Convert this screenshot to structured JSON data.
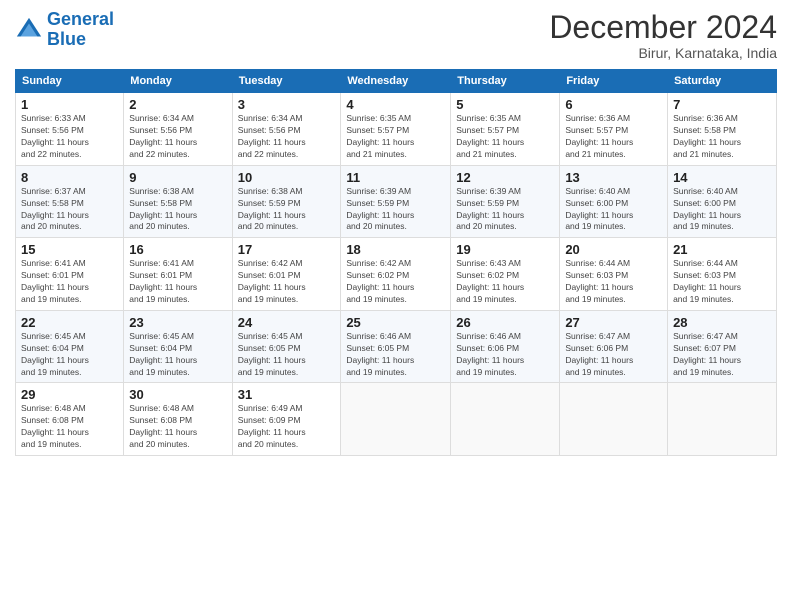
{
  "logo": {
    "line1": "General",
    "line2": "Blue"
  },
  "title": "December 2024",
  "subtitle": "Birur, Karnataka, India",
  "days_header": [
    "Sunday",
    "Monday",
    "Tuesday",
    "Wednesday",
    "Thursday",
    "Friday",
    "Saturday"
  ],
  "weeks": [
    [
      {
        "day": "1",
        "info": "Sunrise: 6:33 AM\nSunset: 5:56 PM\nDaylight: 11 hours\nand 22 minutes."
      },
      {
        "day": "2",
        "info": "Sunrise: 6:34 AM\nSunset: 5:56 PM\nDaylight: 11 hours\nand 22 minutes."
      },
      {
        "day": "3",
        "info": "Sunrise: 6:34 AM\nSunset: 5:56 PM\nDaylight: 11 hours\nand 22 minutes."
      },
      {
        "day": "4",
        "info": "Sunrise: 6:35 AM\nSunset: 5:57 PM\nDaylight: 11 hours\nand 21 minutes."
      },
      {
        "day": "5",
        "info": "Sunrise: 6:35 AM\nSunset: 5:57 PM\nDaylight: 11 hours\nand 21 minutes."
      },
      {
        "day": "6",
        "info": "Sunrise: 6:36 AM\nSunset: 5:57 PM\nDaylight: 11 hours\nand 21 minutes."
      },
      {
        "day": "7",
        "info": "Sunrise: 6:36 AM\nSunset: 5:58 PM\nDaylight: 11 hours\nand 21 minutes."
      }
    ],
    [
      {
        "day": "8",
        "info": "Sunrise: 6:37 AM\nSunset: 5:58 PM\nDaylight: 11 hours\nand 20 minutes."
      },
      {
        "day": "9",
        "info": "Sunrise: 6:38 AM\nSunset: 5:58 PM\nDaylight: 11 hours\nand 20 minutes."
      },
      {
        "day": "10",
        "info": "Sunrise: 6:38 AM\nSunset: 5:59 PM\nDaylight: 11 hours\nand 20 minutes."
      },
      {
        "day": "11",
        "info": "Sunrise: 6:39 AM\nSunset: 5:59 PM\nDaylight: 11 hours\nand 20 minutes."
      },
      {
        "day": "12",
        "info": "Sunrise: 6:39 AM\nSunset: 5:59 PM\nDaylight: 11 hours\nand 20 minutes."
      },
      {
        "day": "13",
        "info": "Sunrise: 6:40 AM\nSunset: 6:00 PM\nDaylight: 11 hours\nand 19 minutes."
      },
      {
        "day": "14",
        "info": "Sunrise: 6:40 AM\nSunset: 6:00 PM\nDaylight: 11 hours\nand 19 minutes."
      }
    ],
    [
      {
        "day": "15",
        "info": "Sunrise: 6:41 AM\nSunset: 6:01 PM\nDaylight: 11 hours\nand 19 minutes."
      },
      {
        "day": "16",
        "info": "Sunrise: 6:41 AM\nSunset: 6:01 PM\nDaylight: 11 hours\nand 19 minutes."
      },
      {
        "day": "17",
        "info": "Sunrise: 6:42 AM\nSunset: 6:01 PM\nDaylight: 11 hours\nand 19 minutes."
      },
      {
        "day": "18",
        "info": "Sunrise: 6:42 AM\nSunset: 6:02 PM\nDaylight: 11 hours\nand 19 minutes."
      },
      {
        "day": "19",
        "info": "Sunrise: 6:43 AM\nSunset: 6:02 PM\nDaylight: 11 hours\nand 19 minutes."
      },
      {
        "day": "20",
        "info": "Sunrise: 6:44 AM\nSunset: 6:03 PM\nDaylight: 11 hours\nand 19 minutes."
      },
      {
        "day": "21",
        "info": "Sunrise: 6:44 AM\nSunset: 6:03 PM\nDaylight: 11 hours\nand 19 minutes."
      }
    ],
    [
      {
        "day": "22",
        "info": "Sunrise: 6:45 AM\nSunset: 6:04 PM\nDaylight: 11 hours\nand 19 minutes."
      },
      {
        "day": "23",
        "info": "Sunrise: 6:45 AM\nSunset: 6:04 PM\nDaylight: 11 hours\nand 19 minutes."
      },
      {
        "day": "24",
        "info": "Sunrise: 6:45 AM\nSunset: 6:05 PM\nDaylight: 11 hours\nand 19 minutes."
      },
      {
        "day": "25",
        "info": "Sunrise: 6:46 AM\nSunset: 6:05 PM\nDaylight: 11 hours\nand 19 minutes."
      },
      {
        "day": "26",
        "info": "Sunrise: 6:46 AM\nSunset: 6:06 PM\nDaylight: 11 hours\nand 19 minutes."
      },
      {
        "day": "27",
        "info": "Sunrise: 6:47 AM\nSunset: 6:06 PM\nDaylight: 11 hours\nand 19 minutes."
      },
      {
        "day": "28",
        "info": "Sunrise: 6:47 AM\nSunset: 6:07 PM\nDaylight: 11 hours\nand 19 minutes."
      }
    ],
    [
      {
        "day": "29",
        "info": "Sunrise: 6:48 AM\nSunset: 6:08 PM\nDaylight: 11 hours\nand 19 minutes."
      },
      {
        "day": "30",
        "info": "Sunrise: 6:48 AM\nSunset: 6:08 PM\nDaylight: 11 hours\nand 20 minutes."
      },
      {
        "day": "31",
        "info": "Sunrise: 6:49 AM\nSunset: 6:09 PM\nDaylight: 11 hours\nand 20 minutes."
      },
      {
        "day": "",
        "info": ""
      },
      {
        "day": "",
        "info": ""
      },
      {
        "day": "",
        "info": ""
      },
      {
        "day": "",
        "info": ""
      }
    ]
  ]
}
